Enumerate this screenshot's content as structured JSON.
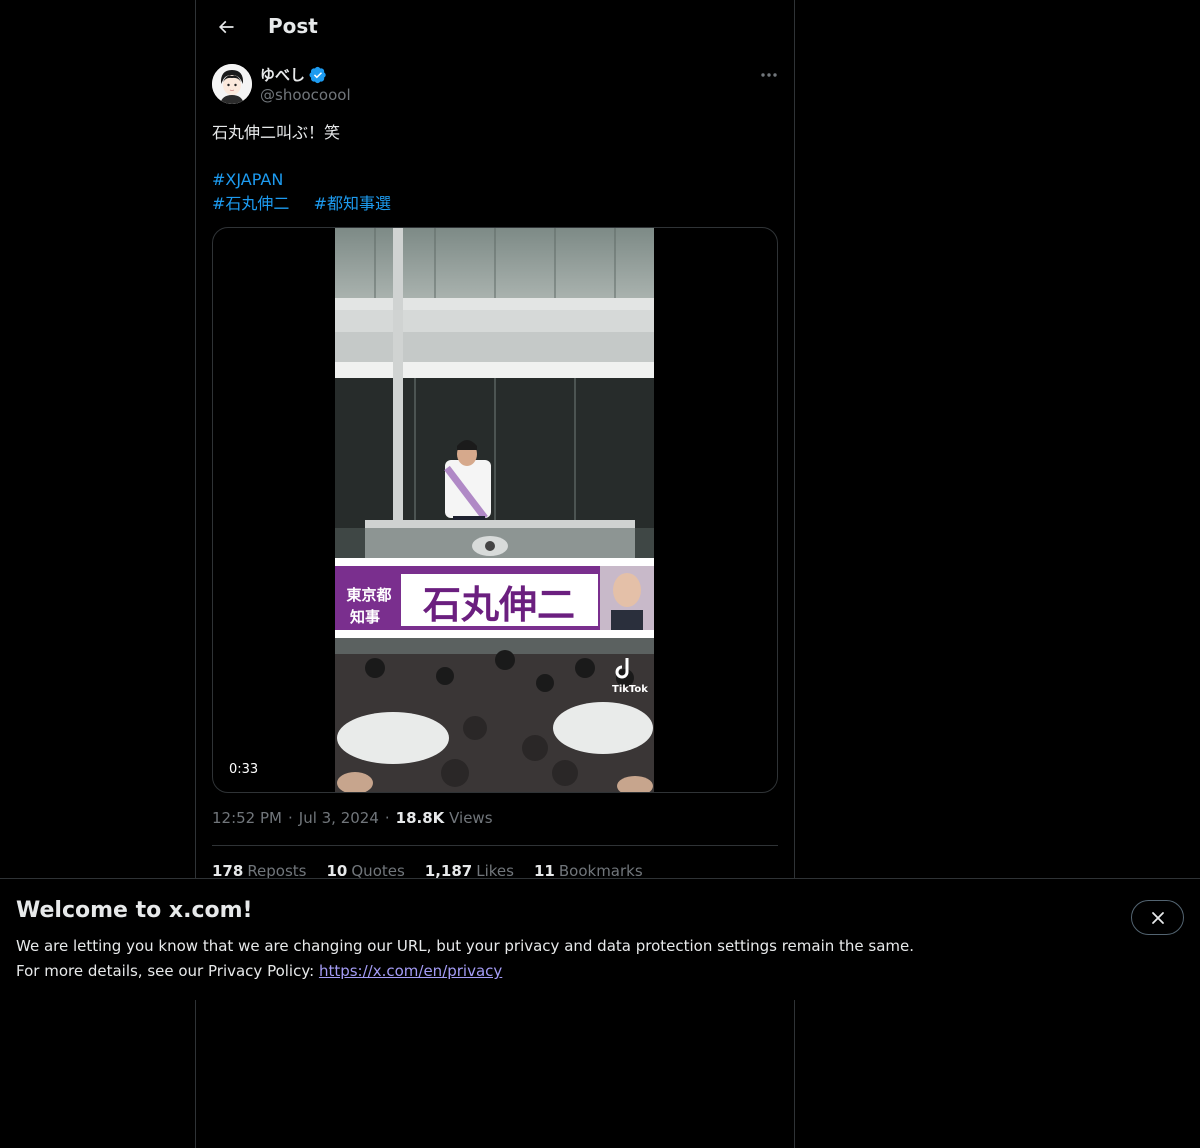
{
  "header": {
    "title": "Post",
    "back_icon": "arrow-left-icon"
  },
  "author": {
    "display_name": "ゆべし",
    "handle": "@shoocoool",
    "verified": true,
    "badge_color": "#1d9bf0"
  },
  "post": {
    "text": "石丸伸二叫ぶ！笑",
    "hashtags_line1": [
      "#XJAPAN"
    ],
    "hashtags_line2": [
      "#石丸伸二",
      "#都知事選"
    ],
    "video": {
      "duration": "0:33",
      "sign_line1": "東京都",
      "sign_line2": "知事",
      "sign_name": "石丸伸二",
      "watermark": "TikTok"
    }
  },
  "meta": {
    "time": "12:52 PM",
    "separator": "·",
    "date": "Jul 3, 2024",
    "views_count": "18.8K",
    "views_label": "Views"
  },
  "stats": [
    {
      "count": "178",
      "label": "Reposts"
    },
    {
      "count": "10",
      "label": "Quotes"
    },
    {
      "count": "1,187",
      "label": "Likes"
    },
    {
      "count": "11",
      "label": "Bookmarks"
    }
  ],
  "banner": {
    "title": "Welcome to x.com!",
    "line1": "We are letting you know that we are changing our URL, but your privacy and data protection settings remain the same.",
    "line2_prefix": "For more details, see our Privacy Policy: ",
    "link": "https://x.com/en/privacy",
    "close_icon": "close-icon"
  },
  "colors": {
    "accent": "#1d9bf0",
    "background": "#000000",
    "muted": "#71767b",
    "link_visited": "#a49cf5"
  }
}
